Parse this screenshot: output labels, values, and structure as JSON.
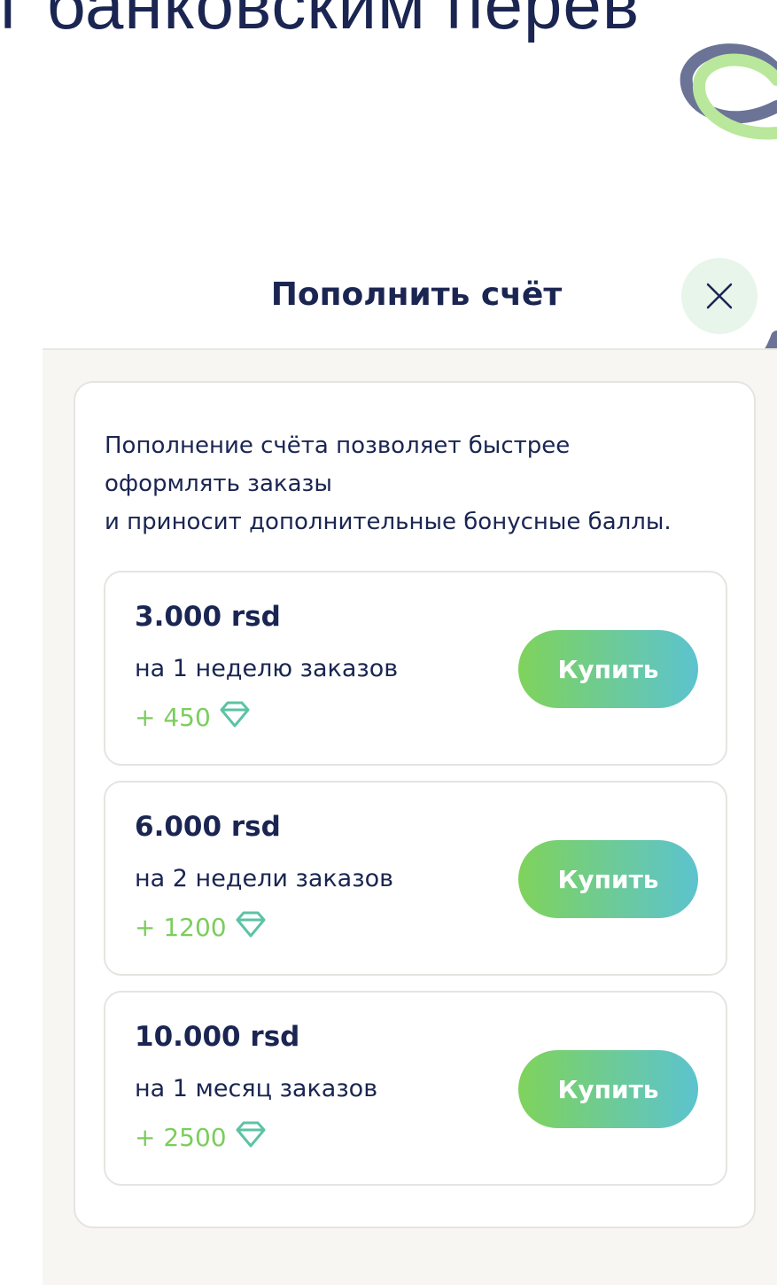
{
  "background": {
    "headline": "г банковским перев"
  },
  "modal": {
    "title": "Пополнить счёт",
    "intro": "Пополнение счёта позволяет быстрее\nоформлять заказы\n и приносит дополнительные бонусные баллы.",
    "offers": [
      {
        "price": "3.000 rsd",
        "description": "на 1 неделю заказов",
        "bonus": "+ 450",
        "button": "Купить"
      },
      {
        "price": "6.000 rsd",
        "description": "на 2 недели заказов",
        "bonus": "+ 1200",
        "button": "Купить"
      },
      {
        "price": "10.000 rsd",
        "description": "на 1 месяц заказов",
        "bonus": "+ 2500",
        "button": "Купить"
      }
    ]
  },
  "icons": {
    "close": "close-icon",
    "bonus": "diamond-icon",
    "decoration": "swirl-arrow"
  },
  "colors": {
    "navy": "#1a2552",
    "accent_green": "#7ccd5d",
    "button_gradient_start": "#7fd35b",
    "button_gradient_end": "#5cc3cf",
    "panel_bg": "#f7f6f3"
  }
}
